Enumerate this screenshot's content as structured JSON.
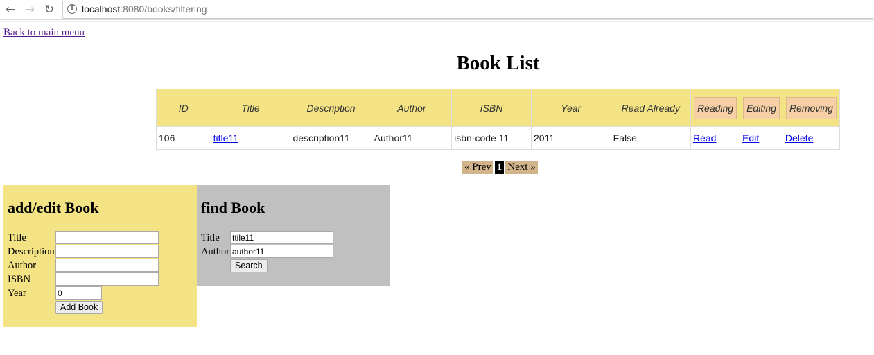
{
  "browser": {
    "back_icon": "back-arrow-icon",
    "forward_icon": "forward-arrow-icon",
    "reload_icon": "reload-icon",
    "url_host": "localhost",
    "url_path": ":8080/books/filtering"
  },
  "back_link": "Back to main menu",
  "title": "Book List",
  "table": {
    "headers": [
      "ID",
      "Title",
      "Description",
      "Author",
      "ISBN",
      "Year",
      "Read Already",
      "Reading",
      "Editing",
      "Removing"
    ],
    "rows": [
      {
        "id": "106",
        "title": "title11",
        "description": "description11",
        "author": "Author11",
        "isbn": "isbn-code 11",
        "year": "2011",
        "read_already": "False",
        "read_link": "Read",
        "edit_link": "Edit",
        "delete_link": "Delete"
      }
    ]
  },
  "pager": {
    "prev": "« Prev",
    "current": "1",
    "next": "Next »"
  },
  "add_panel": {
    "heading": "add/edit Book",
    "fields": {
      "title": {
        "label": "Title",
        "value": ""
      },
      "description": {
        "label": "Description",
        "value": ""
      },
      "author": {
        "label": "Author",
        "value": ""
      },
      "isbn": {
        "label": "ISBN",
        "value": ""
      },
      "year": {
        "label": "Year",
        "value": "0"
      }
    },
    "button": "Add Book"
  },
  "find_panel": {
    "heading": "find Book",
    "fields": {
      "title": {
        "label": "Title",
        "value": "ttile11"
      },
      "author": {
        "label": "Author",
        "value": "author11"
      }
    },
    "button": "Search"
  },
  "colors": {
    "panel_yellow": "#f3e384",
    "panel_gray": "#c0c0c0",
    "pager_tan": "#d2b48c",
    "action_header": "#f6cfa5"
  }
}
